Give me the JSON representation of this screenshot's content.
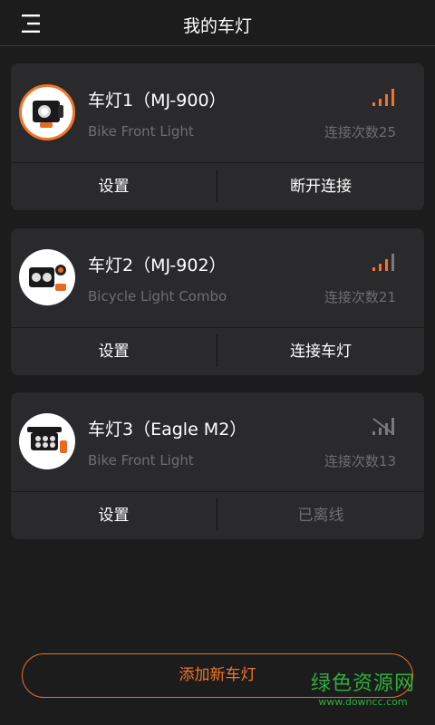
{
  "header": {
    "title": "我的车灯",
    "menu_icon": "menu-icon"
  },
  "lights": [
    {
      "name": "车灯1（MJ-900）",
      "subtitle": "Bike Front Light",
      "count": "连接次数25",
      "signal_bars": 4,
      "connected": true,
      "left_action": "设置",
      "right_action": "断开连接"
    },
    {
      "name": "车灯2（MJ-902）",
      "subtitle": "Bicycle Light Combo",
      "count": "连接次数21",
      "signal_bars": 3,
      "connected": false,
      "left_action": "设置",
      "right_action": "连接车灯"
    },
    {
      "name": "车灯3（Eagle M2）",
      "subtitle": "Bike Front Light",
      "count": "连接次数13",
      "signal_bars": 0,
      "connected": false,
      "left_action": "设置",
      "right_action": "已离线"
    }
  ],
  "add_button": "添加新车灯",
  "watermark": {
    "main": "绿色资源网",
    "sub": "www.downcc.com"
  },
  "colors": {
    "accent": "#f0752a",
    "background": "#1c1c1d",
    "card": "#2a2a2c",
    "muted": "#6e6e72",
    "watermark": "#2fae3a"
  }
}
